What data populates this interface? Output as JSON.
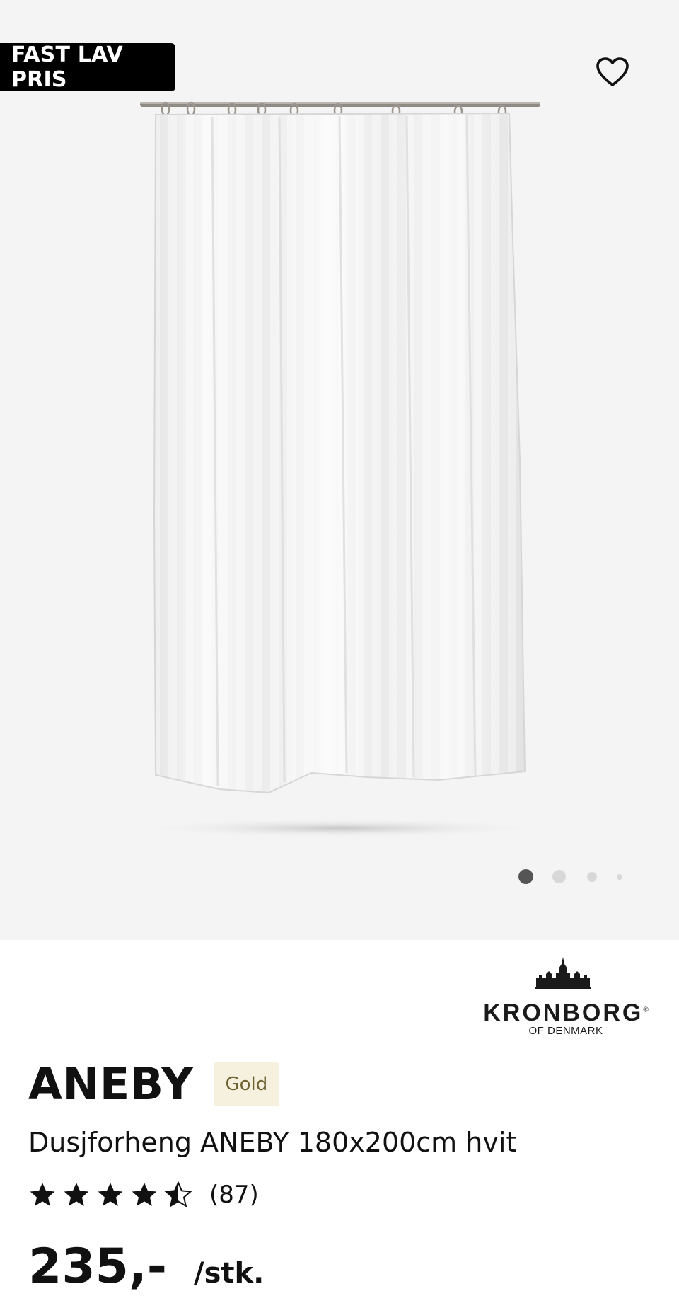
{
  "gallery": {
    "badge_label": "FAST LAV PRIS",
    "image_alt": "Dusjforheng ANEBY 180x200cm hvit",
    "dots": [
      {
        "active": true
      },
      {
        "active": false
      },
      {
        "active": false
      },
      {
        "active": false
      }
    ]
  },
  "brand": {
    "name": "KRONBORG",
    "registered": "®",
    "subtitle": "OF DENMARK"
  },
  "product": {
    "title": "ANEBY",
    "tier_badge": "Gold",
    "description": "Dusjforheng ANEBY 180x200cm hvit",
    "rating_value": 4.5,
    "rating_count": "(87)",
    "price": "235,-",
    "unit": "/stk."
  },
  "icons": {
    "favorite": "heart-outline-icon",
    "star_full": "star-filled-icon",
    "star_half": "star-half-icon"
  },
  "colors": {
    "badge_bg": "#000000",
    "gold_bg": "#f6f1df",
    "gold_text": "#6f6431",
    "gallery_bg": "#f4f4f4",
    "dot_active": "#555555",
    "dot_inactive": "#d8d8d8"
  }
}
